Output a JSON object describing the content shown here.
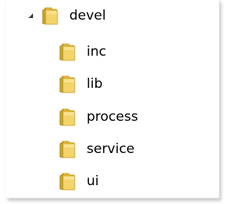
{
  "tree": {
    "root": {
      "label": "devel",
      "expanded": true,
      "icon": "folder-icon"
    },
    "children": [
      {
        "label": "inc",
        "icon": "folder-icon"
      },
      {
        "label": "lib",
        "icon": "folder-icon"
      },
      {
        "label": "process",
        "icon": "folder-icon"
      },
      {
        "label": "service",
        "icon": "folder-icon"
      },
      {
        "label": "ui",
        "icon": "folder-icon"
      }
    ]
  },
  "colors": {
    "folder_body": "#e8c34a",
    "folder_front": "#f3d56a",
    "folder_edge": "#c9a12c",
    "expander": "#404040"
  }
}
